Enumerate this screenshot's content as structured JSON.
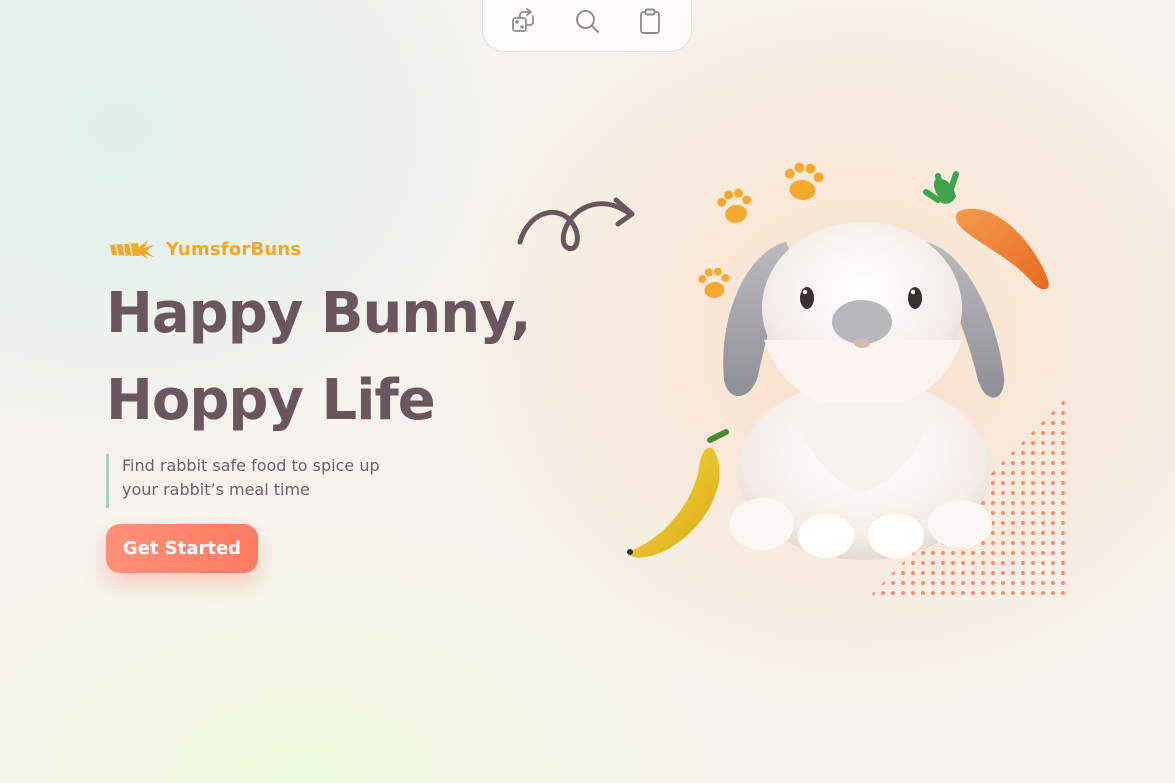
{
  "toolbar": {
    "buttons": [
      {
        "icon": "dice-share-icon"
      },
      {
        "icon": "search-icon"
      },
      {
        "icon": "clipboard-icon"
      }
    ]
  },
  "brand": {
    "name": "YumsforBuns",
    "logo_icon": "carrot-logo-icon"
  },
  "hero": {
    "headline_line1": "Happy Bunny,",
    "headline_line2": "Hoppy Life",
    "tagline_line1": "Find rabbit safe food to spice up",
    "tagline_line2": "your rabbit’s meal time",
    "cta_label": "Get Started"
  },
  "colors": {
    "brand": "#f2a62a",
    "heading": "#6b555f",
    "accent": "#fb7a62",
    "divider": "#a8cdbf"
  }
}
